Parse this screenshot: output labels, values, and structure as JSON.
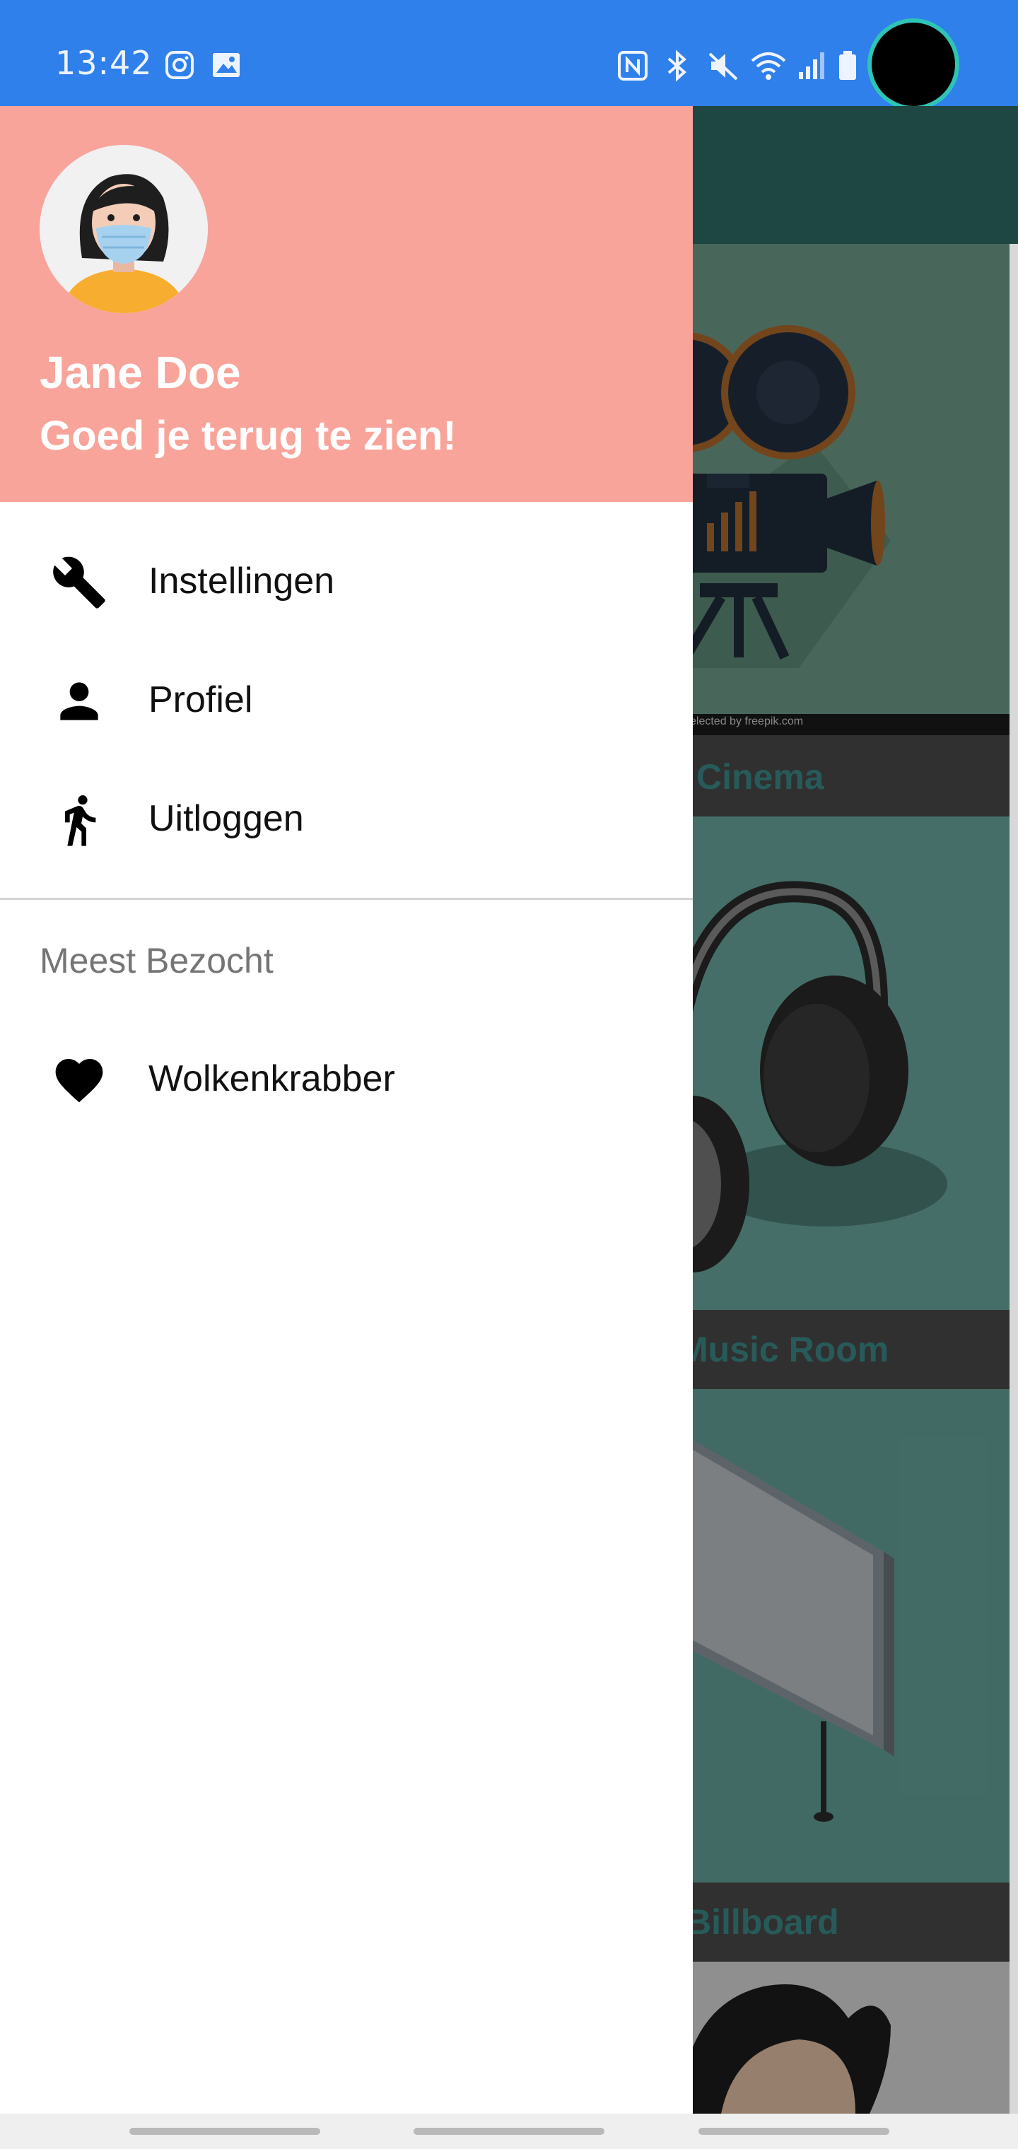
{
  "status_bar": {
    "time": "13:42",
    "left_icons": [
      "instagram-icon",
      "image-icon"
    ],
    "right_icons": [
      "nfc-icon",
      "bluetooth-icon",
      "mute-icon",
      "wifi-icon",
      "signal-icon",
      "battery-icon"
    ],
    "color": "#2f80ea"
  },
  "drawer": {
    "header": {
      "name": "Jane Doe",
      "welcome": "Goed je terug te zien!",
      "background": "#f8a49a"
    },
    "items": [
      {
        "label": "Instellingen",
        "icon": "wrench-icon"
      },
      {
        "label": "Profiel",
        "icon": "person-icon"
      },
      {
        "label": "Uitloggen",
        "icon": "walking-person-icon"
      }
    ],
    "section_title": "Meest Bezocht",
    "visited": [
      {
        "label": "Wolkenkrabber",
        "icon": "heart-icon"
      }
    ]
  },
  "background_app": {
    "cards": [
      {
        "caption": "Cinema",
        "credit": "selected by freepik.com"
      },
      {
        "caption": "Music Room"
      },
      {
        "caption": "Billboard"
      }
    ]
  }
}
